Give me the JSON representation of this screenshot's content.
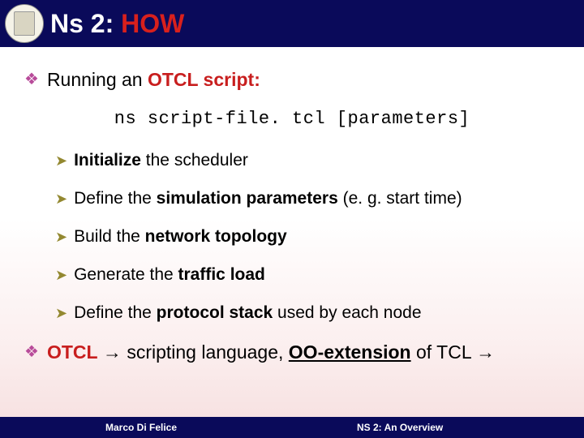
{
  "title": {
    "part1": "Ns 2: ",
    "part2": "HOW"
  },
  "main_bullets": [
    {
      "prefix": "Running an ",
      "bold": "OTCL script:",
      "suffix": ""
    }
  ],
  "command": "ns script-file. tcl [parameters]",
  "sub_bullets": [
    {
      "pre": "",
      "b1": "Initialize",
      "mid": " the scheduler",
      "b2": "",
      "post": ""
    },
    {
      "pre": "Define the ",
      "b1": "simulation parameters",
      "mid": " (e. g. start time)",
      "b2": "",
      "post": ""
    },
    {
      "pre": "Build the ",
      "b1": "network topology",
      "mid": "",
      "b2": "",
      "post": ""
    },
    {
      "pre": "Generate the ",
      "b1": "traffic load",
      "mid": "",
      "b2": "",
      "post": ""
    },
    {
      "pre": "Define the ",
      "b1": "protocol stack",
      "mid": " used by each node",
      "b2": "",
      "post": ""
    }
  ],
  "otcl_bullet": {
    "b1": "OTCL",
    "arrow1": " → ",
    "mid": "scripting language, ",
    "b2": "OO-extension",
    "post": " of TCL →"
  },
  "footer": {
    "left": "Marco Di Felice",
    "right": "NS 2: An Overview"
  }
}
